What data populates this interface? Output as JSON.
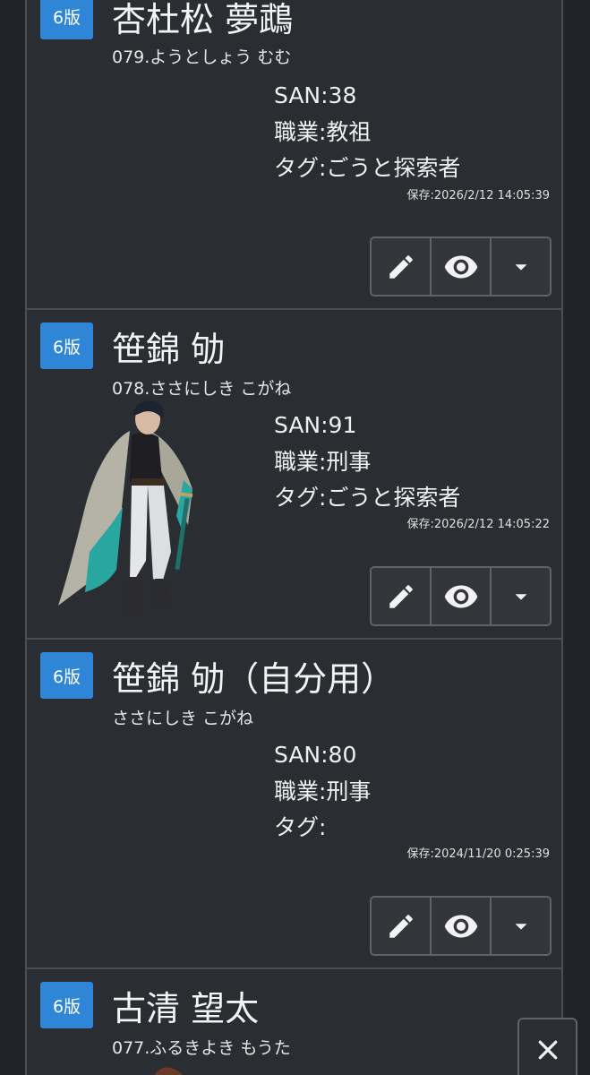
{
  "characters": [
    {
      "edition": "6版",
      "name": "杏杜松 夢鵡",
      "kana": "079.ようとしょう むむ",
      "san": "SAN:38",
      "job": "職業:教祖",
      "tags": "タグ:ごうと探索者",
      "saved": "保存:2026/2/12 14:05:39",
      "has_portrait": false
    },
    {
      "edition": "6版",
      "name": "笹錦 劬",
      "kana": "078.ささにしき こがね",
      "san": "SAN:91",
      "job": "職業:刑事",
      "tags": "タグ:ごうと探索者",
      "saved": "保存:2026/2/12 14:05:22",
      "has_portrait": true
    },
    {
      "edition": "6版",
      "name": "笹錦 劬（自分用）",
      "kana": "ささにしき こがね",
      "san": "SAN:80",
      "job": "職業:刑事",
      "tags": "タグ:",
      "saved": "保存:2024/11/20 0:25:39",
      "has_portrait": false
    },
    {
      "edition": "6版",
      "name": "古清 望太",
      "kana": "077.ふるきよき もうた",
      "has_portrait": false
    }
  ],
  "actions": {
    "edit_icon": "pencil-icon",
    "view_icon": "eye-icon",
    "menu_icon": "caret-down-icon"
  },
  "close_icon": "close-icon",
  "colors": {
    "background": "#202327",
    "card": "#2a2d31",
    "card_border": "#4b4f55",
    "badge": "#2f86d6",
    "text": "#f1f1f1"
  }
}
